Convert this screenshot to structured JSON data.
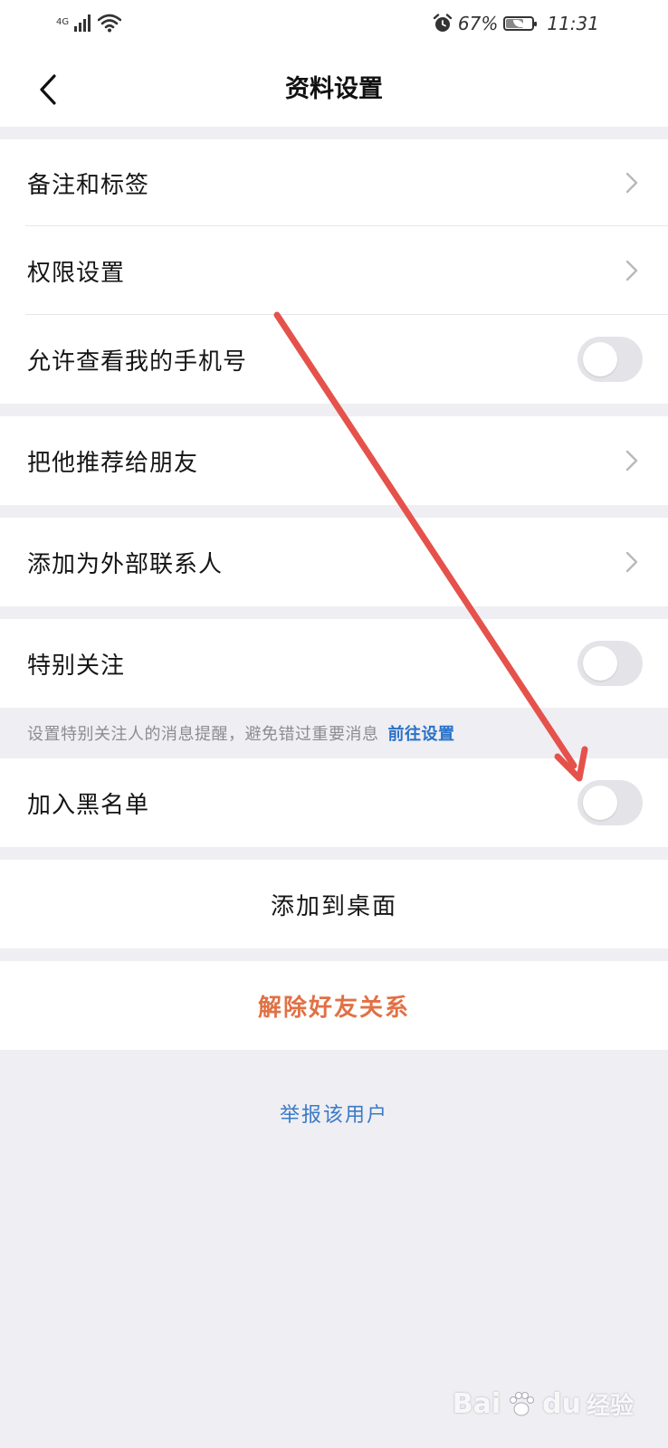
{
  "status_bar": {
    "network": "4G",
    "battery_percent": "67%",
    "battery_level": 0.67,
    "time": "11:31",
    "icons": [
      "signal-icon",
      "wifi-icon",
      "alarm-icon",
      "battery-icon"
    ]
  },
  "nav": {
    "title": "资料设置",
    "back_icon": "chevron-left-icon"
  },
  "rows": {
    "notes_tags": "备注和标签",
    "permissions": "权限设置",
    "allow_phone": "允许查看我的手机号",
    "recommend": "把他推荐给朋友",
    "external_contact": "添加为外部联系人",
    "special_follow": "特别关注",
    "blacklist": "加入黑名单",
    "add_desktop": "添加到桌面",
    "remove_friend": "解除好友关系"
  },
  "toggles": {
    "allow_phone": false,
    "special_follow": false,
    "blacklist": false
  },
  "hint": {
    "text": "设置特别关注人的消息提醒，避免错过重要消息",
    "link": "前往设置"
  },
  "report": "举报该用户",
  "watermark": {
    "text": "Bai",
    "text2": "du",
    "text3": "经验"
  },
  "colors": {
    "accent_link": "#2a72c8",
    "danger": "#e07145",
    "report": "#3b7ac6",
    "annotation_arrow": "#e5524b",
    "background": "#eeeef3"
  }
}
